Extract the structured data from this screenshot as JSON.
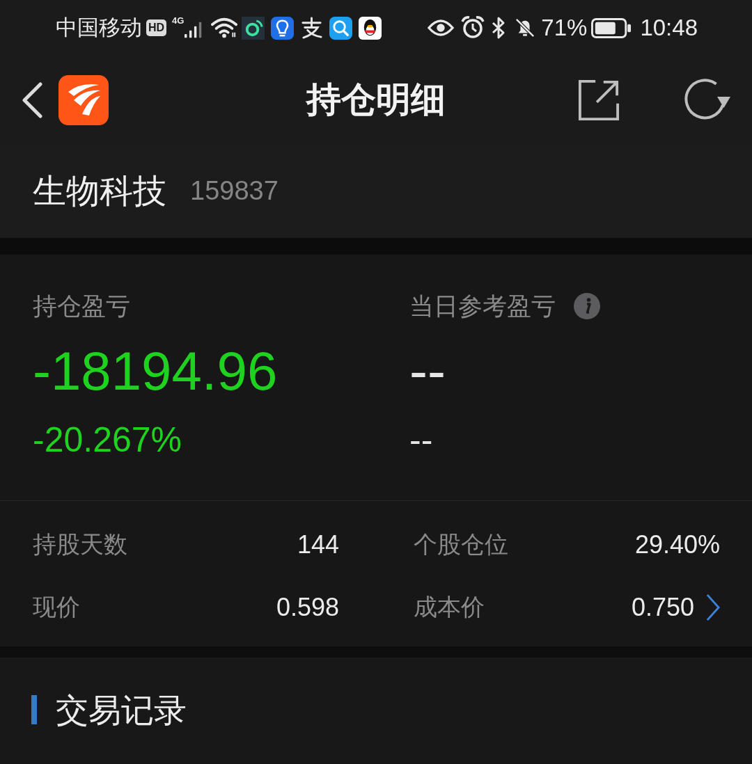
{
  "status_bar": {
    "carrier": "中国移动",
    "hd_label": "HD",
    "network_type": "4G",
    "battery_percent": "71%",
    "time": "10:48"
  },
  "header": {
    "title": "持仓明细"
  },
  "stock": {
    "name": "生物科技",
    "code": "159837"
  },
  "pnl": [
    {
      "label": "持仓盈亏",
      "info_icon": false,
      "color": "#1fd21f",
      "value": "-18194.96",
      "percent": "-20.267%"
    },
    {
      "label": "当日参考盈亏",
      "info_icon": true,
      "color": "#e6e6e6",
      "value": "--",
      "percent": "--"
    }
  ],
  "stats": [
    {
      "label": "持股天数",
      "value": "144",
      "link": false
    },
    {
      "label": "个股仓位",
      "value": "29.40%",
      "link": false
    },
    {
      "label": "现价",
      "value": "0.598",
      "link": false
    },
    {
      "label": "成本价",
      "value": "0.750",
      "link": true
    }
  ],
  "section": {
    "title": "交易记录"
  }
}
